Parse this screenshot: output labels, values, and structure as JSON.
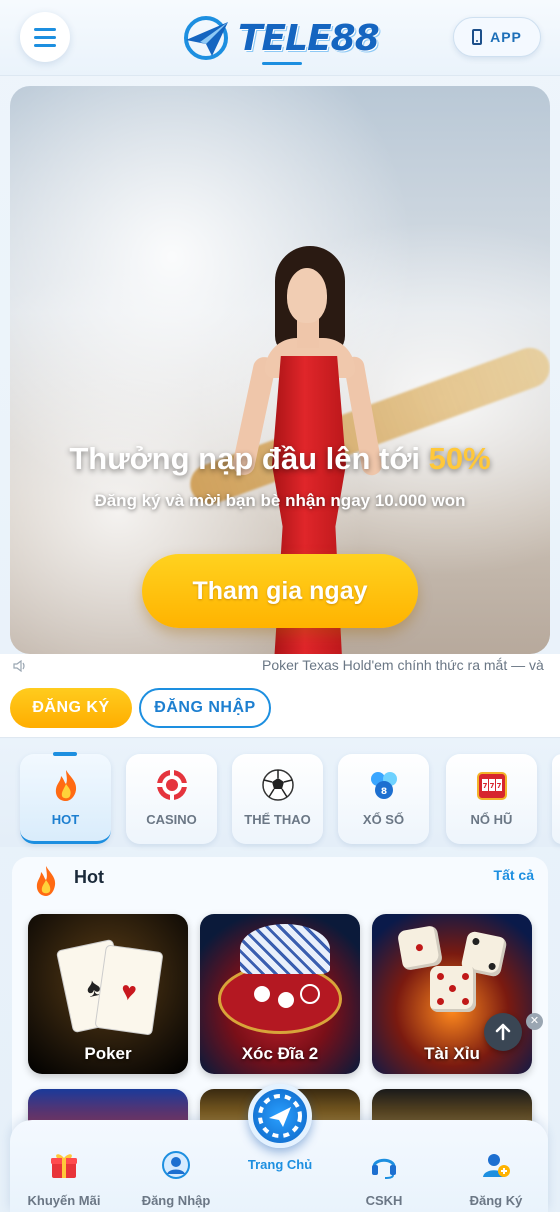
{
  "header": {
    "logo_text": "TELE88",
    "app_button_label": "APP"
  },
  "banner": {
    "title_main": "Thưởng nạp đầu lên tới ",
    "title_highlight": "50%",
    "subtitle": "Đăng ký và mời bạn bè nhận ngay 10.000 won",
    "cta_label": "Tham gia ngay"
  },
  "marquee": {
    "text": "Poker Texas Hold'em chính thức ra mắt — và"
  },
  "auth": {
    "register_label": "ĐĂNG KÝ",
    "login_label": "ĐĂNG NHẬP"
  },
  "categories": [
    {
      "label": "HOT",
      "icon": "flame-icon",
      "active": true
    },
    {
      "label": "CASINO",
      "icon": "casino-chip-icon",
      "active": false
    },
    {
      "label": "THỂ THAO",
      "icon": "soccer-ball-icon",
      "active": false
    },
    {
      "label": "XỔ SỐ",
      "icon": "lottery-icon",
      "active": false
    },
    {
      "label": "NỔ HŨ",
      "icon": "slot-machine-icon",
      "active": false
    }
  ],
  "hot_section": {
    "title": "Hot",
    "see_all_label": "Tất cả",
    "games": [
      {
        "label": "Poker"
      },
      {
        "label": "Xóc Đĩa 2"
      },
      {
        "label": "Tài Xỉu"
      }
    ]
  },
  "bottom_nav": {
    "items": [
      {
        "label": "Khuyến Mãi",
        "icon": "gift-icon"
      },
      {
        "label": "Đăng Nhập",
        "icon": "user-icon"
      },
      {
        "label": "Trang Chủ",
        "icon": "home-chip-icon"
      },
      {
        "label": "CSKH",
        "icon": "headset-icon"
      },
      {
        "label": "Đăng Ký",
        "icon": "add-user-icon"
      }
    ]
  },
  "colors": {
    "accent_blue": "#1d8fe0",
    "accent_yellow": "#ffb300",
    "highlight_gold": "#ffc83a"
  }
}
